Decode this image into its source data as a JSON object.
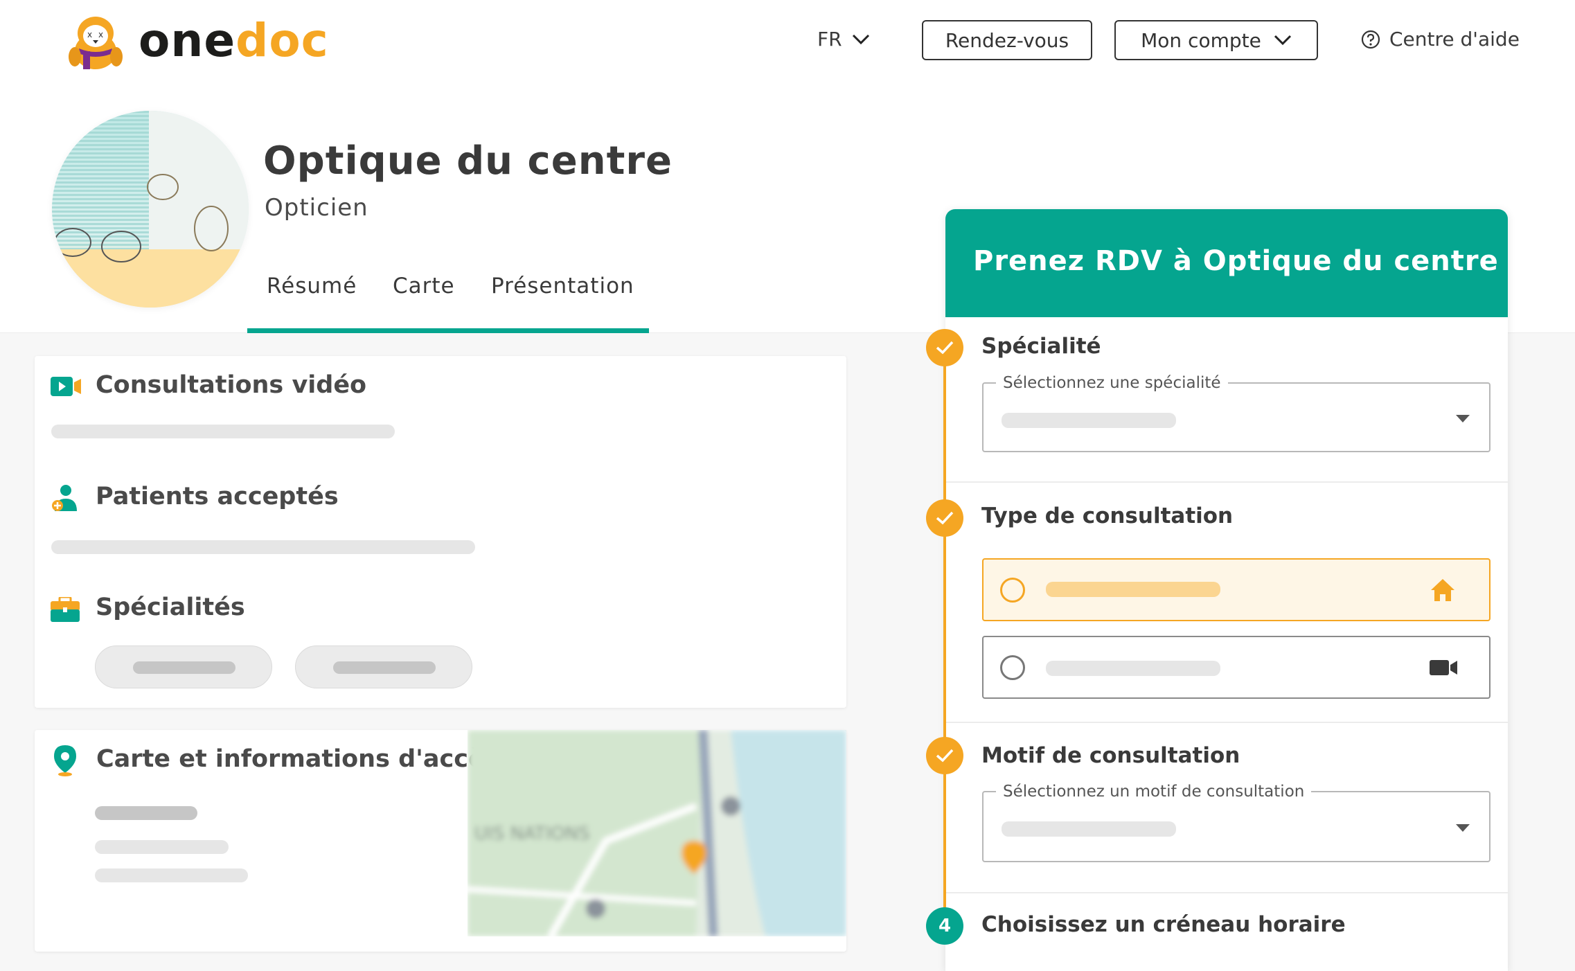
{
  "header": {
    "brand_part1": "one",
    "brand_part2": "doc",
    "language": "FR",
    "appointments_button": "Rendez-vous",
    "account_button": "Mon compte",
    "help_link": "Centre d'aide"
  },
  "profile": {
    "name": "Optique du centre",
    "category": "Opticien",
    "tabs": [
      "Résumé",
      "Carte",
      "Présentation"
    ]
  },
  "sections": {
    "video": "Consultations vidéo",
    "patients": "Patients acceptés",
    "specialties": "Spécialités",
    "map": "Carte et informations d'accès"
  },
  "booking": {
    "title": "Prenez RDV à Optique du centre",
    "step1_title": "Spécialité",
    "step1_placeholder": "Sélectionnez une spécialité",
    "step2_title": "Type de consultation",
    "step3_title": "Motif de consultation",
    "step3_placeholder": "Sélectionnez un motif de consultation",
    "step4_number": "4",
    "step4_title": "Choisissez un créneau horaire"
  },
  "colors": {
    "brand_green": "#05a58f",
    "brand_orange": "#f5a623",
    "text_dark": "#3a3a3a"
  },
  "icons": [
    "chevron-down-icon",
    "help-circle-icon",
    "video-camera-icon",
    "patient-icon",
    "briefcase-icon",
    "map-pin-icon",
    "check-icon",
    "home-icon",
    "dropdown-arrow-icon"
  ]
}
